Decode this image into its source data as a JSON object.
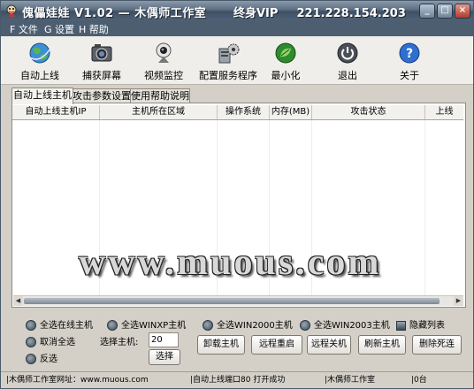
{
  "title": {
    "app_name": "傀儡娃娃 V1.02",
    "separator": "—",
    "studio": "木偶师工作室",
    "vip_label": "终身VIP",
    "ip": "221.228.154.203"
  },
  "menu": [
    {
      "label": "F 文件"
    },
    {
      "label": "G 设置"
    },
    {
      "label": "H 帮助"
    }
  ],
  "toolbar": [
    {
      "label": "自动上线",
      "icon": "globe-icon"
    },
    {
      "label": "捕获屏幕",
      "icon": "screen-capture-icon"
    },
    {
      "label": "视频监控",
      "icon": "webcam-icon"
    },
    {
      "label": "配置服务程序",
      "icon": "server-config-icon"
    },
    {
      "label": "最小化",
      "icon": "minimize-leaf-icon"
    },
    {
      "label": "退出",
      "icon": "power-icon"
    },
    {
      "label": "关于",
      "icon": "help-icon"
    }
  ],
  "tabs": [
    {
      "label": "自动上线主机",
      "active": true
    },
    {
      "label": "攻击参数设置",
      "active": false
    },
    {
      "label": "使用帮助说明",
      "active": false
    }
  ],
  "columns": [
    "自动上线主机IP",
    "主机所在区域",
    "操作系统",
    "内存(MB)",
    "攻击状态",
    "上线"
  ],
  "watermark": "www.muous.com",
  "controls": {
    "select_all_online": "全选在线主机",
    "select_all_winxp": "全选WINXP主机",
    "select_all_win2000": "全选WIN2000主机",
    "select_all_win2003": "全选WIN2003主机",
    "hide_list": "隐藏列表",
    "deselect_all": "取消全选",
    "invert": "反选",
    "select_hosts_label": "选择主机:",
    "select_hosts_value": "20",
    "select_button": "选择",
    "unload_button": "卸载主机",
    "restart_button": "远程重启",
    "shutdown_button": "远程关机",
    "refresh_button": "刷新主机",
    "remove_dead_button": "删除死连"
  },
  "status": {
    "website": "|木偶师工作室网址：www.muous.com",
    "port_status": "|自动上线端口80 打开成功",
    "studio": "|木偶师工作室",
    "count": "|0台"
  },
  "colors": {
    "titlebar": "#4e6176",
    "menubar": "#4d5e71",
    "toolbar_bg": "#f0eeea",
    "window_bg": "#d4d0c8"
  }
}
